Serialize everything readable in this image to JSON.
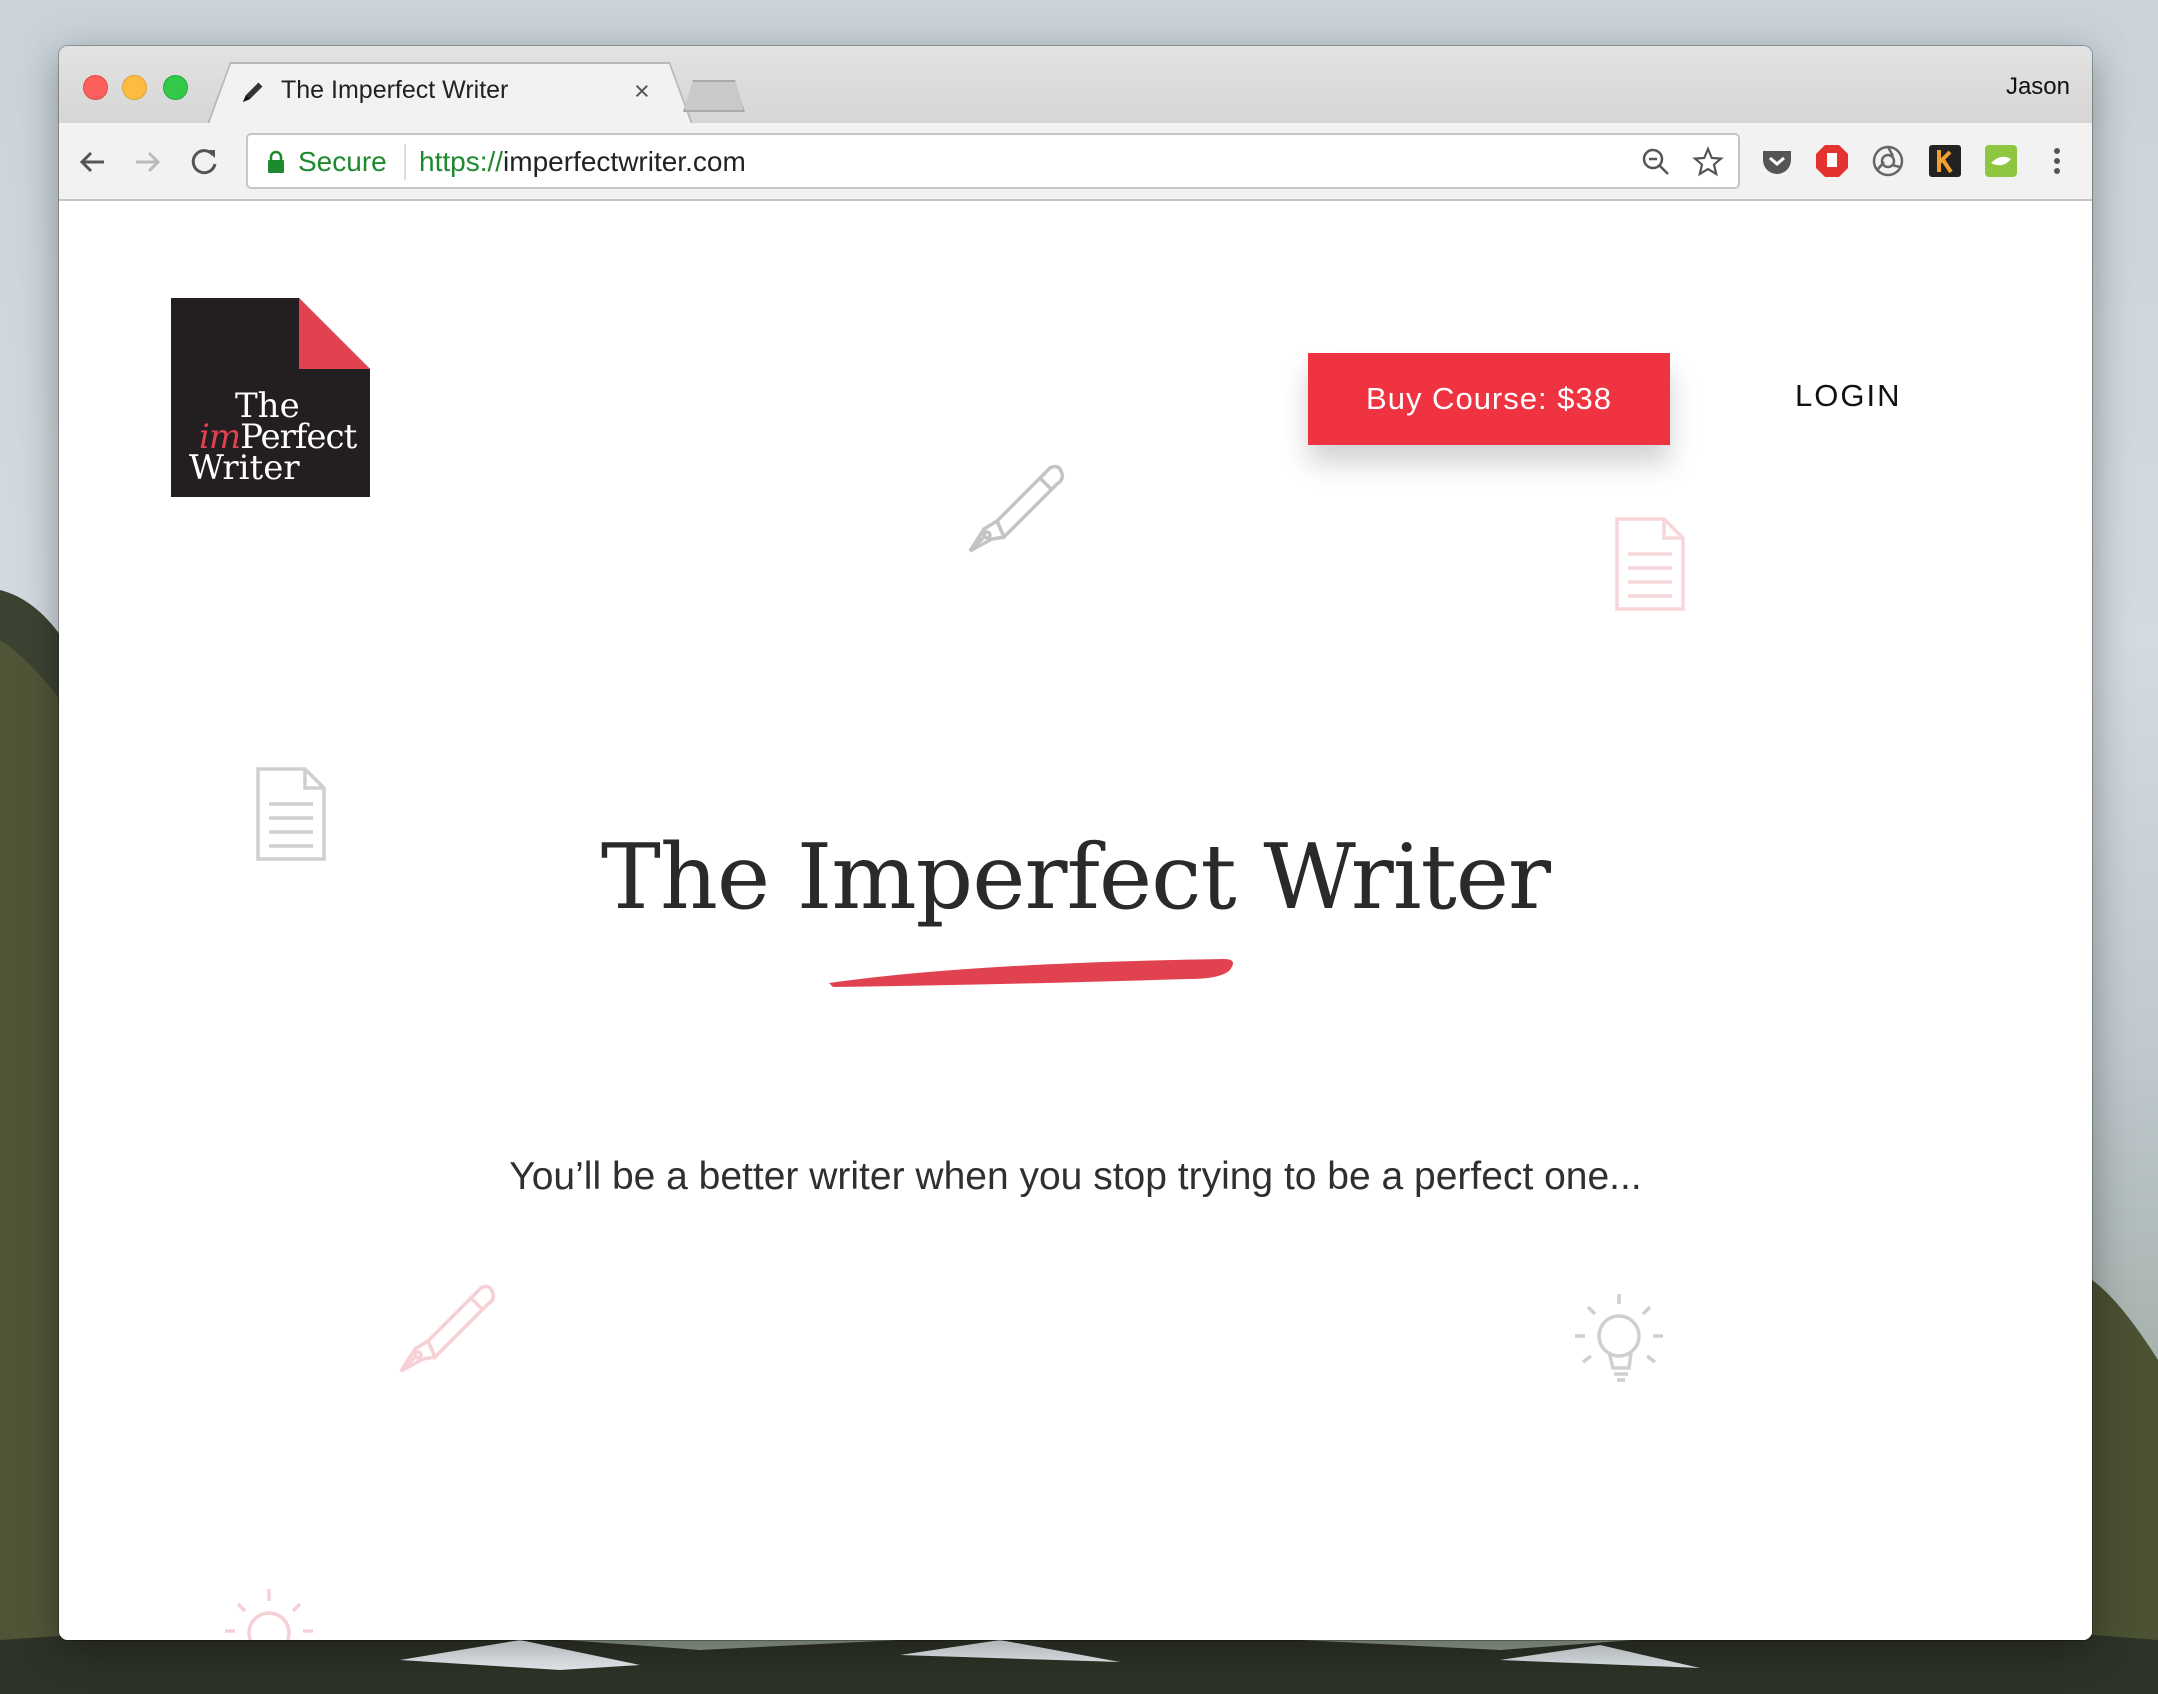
{
  "browser": {
    "tab_title": "The Imperfect Writer",
    "tab_close": "×",
    "profile_name": "Jason",
    "secure_label": "Secure",
    "url_protocol": "https://",
    "url_host": "imperfectwriter.com"
  },
  "site": {
    "logo": {
      "line1": "The",
      "line2_accent": "im",
      "line2_rest": "Perfect",
      "line3": "Writer"
    },
    "buy_button": "Buy Course: $38",
    "login": "LOGIN",
    "hero_title": "The Imperfect Writer",
    "tagline": "You’ll be a better writer when you stop trying to be a perfect one..."
  },
  "colors": {
    "accent_red": "#ef3341",
    "logo_bg": "#231f20",
    "secure_green": "#1e8a2e"
  },
  "icons": [
    "pen-icon",
    "back-arrow-icon",
    "forward-arrow-icon",
    "reload-icon",
    "lock-icon",
    "zoom-icon",
    "star-icon",
    "pocket-icon",
    "adblock-icon",
    "chrome-ext-icon",
    "k-ext-icon",
    "grammarly-ext-icon",
    "menu-dots-icon",
    "fountain-pen-icon",
    "document-icon",
    "lightbulb-icon"
  ]
}
